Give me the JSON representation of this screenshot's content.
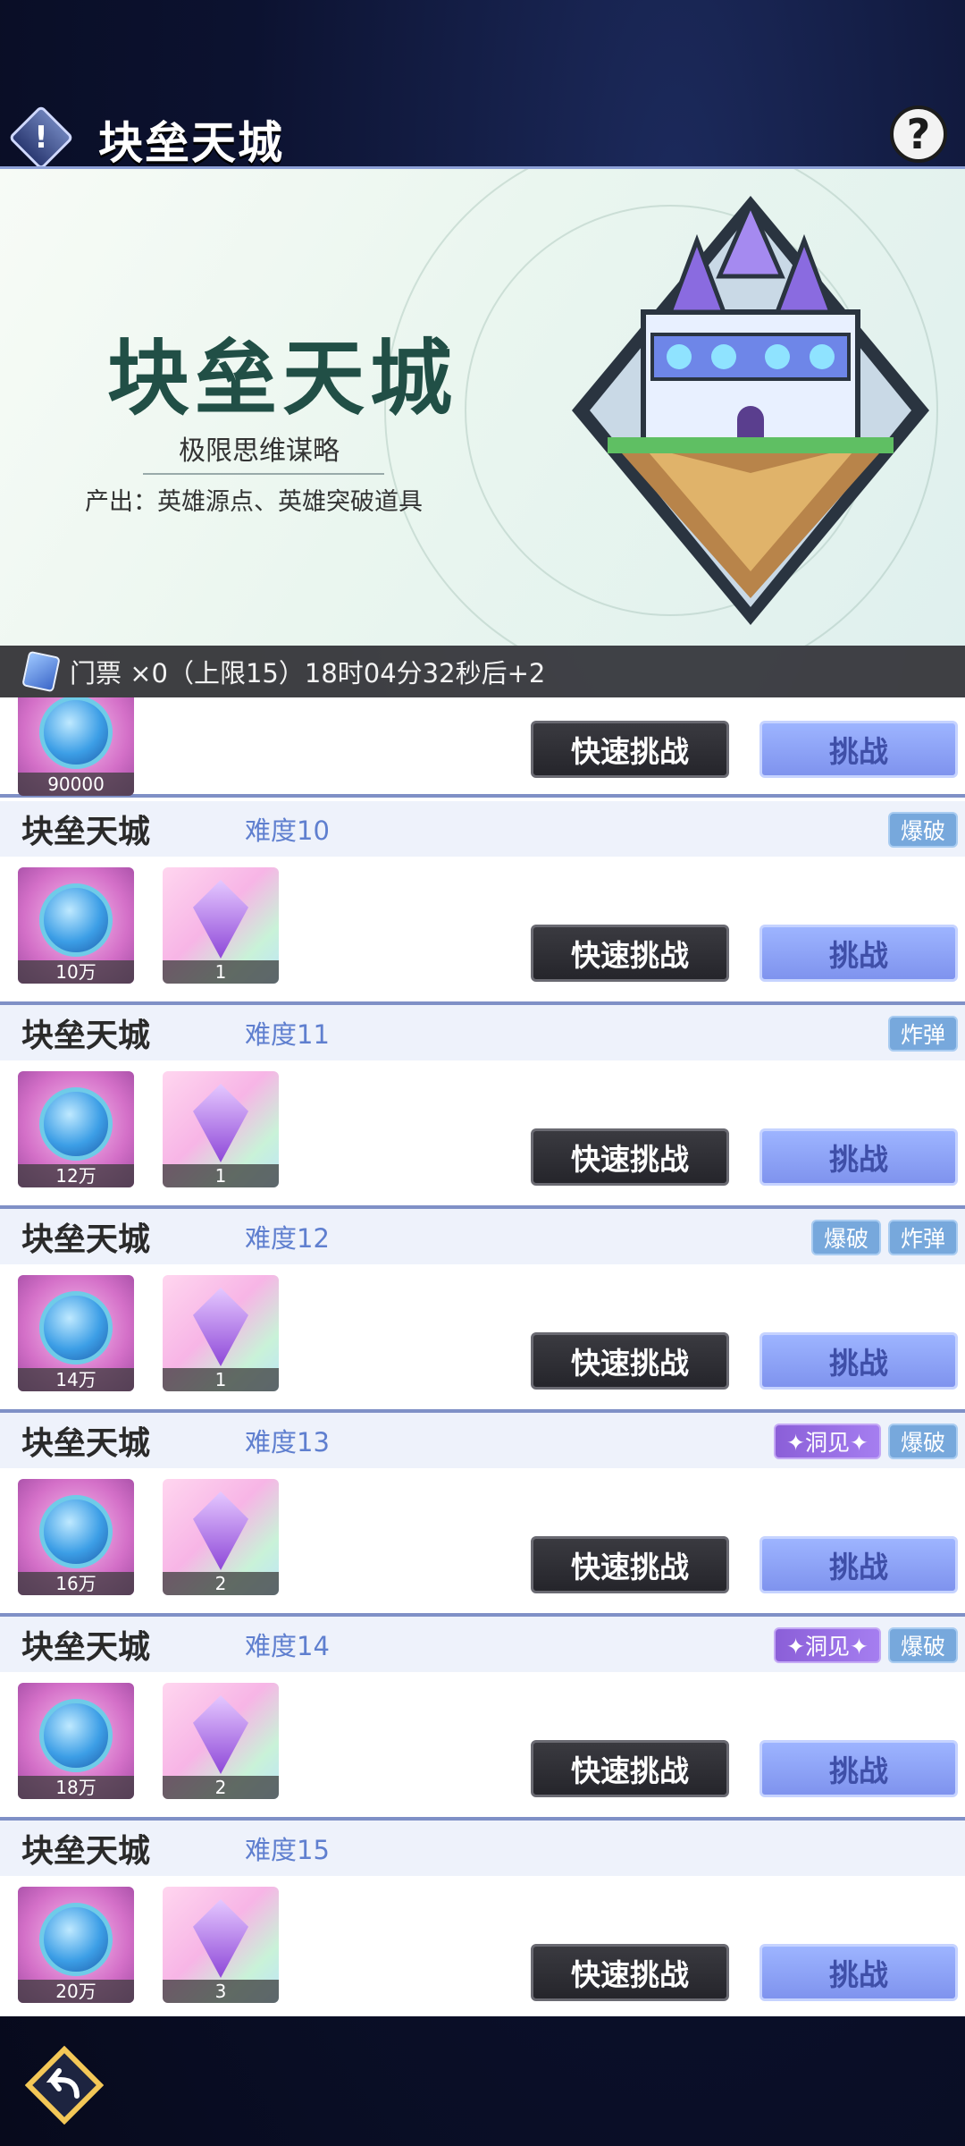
{
  "header": {
    "title": "块垒天城",
    "info_icon": "exclamation",
    "help_icon": "question"
  },
  "banner": {
    "title": "块垒天城",
    "subtitle": "极限思维谋略",
    "output": "产出：英雄源点、英雄突破道具"
  },
  "ticket": {
    "text": "门票 ×0（上限15）18时04分32秒后+2"
  },
  "buttons": {
    "quick": "快速挑战",
    "fight": "挑战"
  },
  "partial_row": {
    "reward_amount": "90000"
  },
  "rows": [
    {
      "name": "块垒天城",
      "difficulty": "难度10",
      "tags": [
        "爆破"
      ],
      "reward1": "10万",
      "reward2": "1"
    },
    {
      "name": "块垒天城",
      "difficulty": "难度11",
      "tags": [
        "炸弹"
      ],
      "reward1": "12万",
      "reward2": "1"
    },
    {
      "name": "块垒天城",
      "difficulty": "难度12",
      "tags": [
        "爆破",
        "炸弹"
      ],
      "reward1": "14万",
      "reward2": "1"
    },
    {
      "name": "块垒天城",
      "difficulty": "难度13",
      "tags": [
        "✦洞见✦",
        "爆破"
      ],
      "reward1": "16万",
      "reward2": "2"
    },
    {
      "name": "块垒天城",
      "difficulty": "难度14",
      "tags": [
        "✦洞见✦",
        "爆破"
      ],
      "reward1": "18万",
      "reward2": "2"
    },
    {
      "name": "块垒天城",
      "difficulty": "难度15",
      "tags": [],
      "reward1": "20万",
      "reward2": "3"
    }
  ]
}
